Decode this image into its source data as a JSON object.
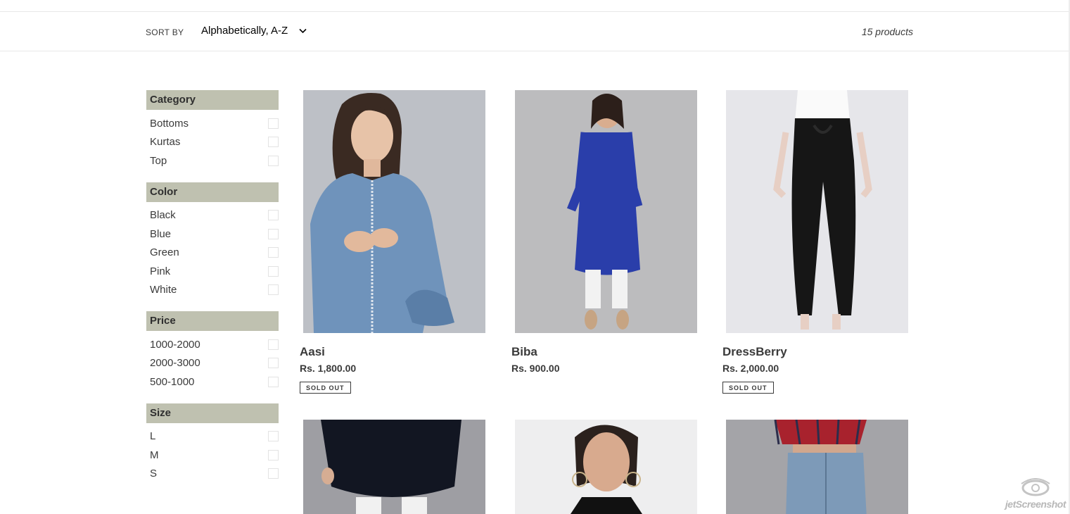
{
  "toolbar": {
    "sort_label": "SORT BY",
    "sort_value": "Alphabetically, A-Z",
    "product_count": "15 products"
  },
  "filters": [
    {
      "header": "Category",
      "options": [
        "Bottoms",
        "Kurtas",
        "Top"
      ]
    },
    {
      "header": "Color",
      "options": [
        "Black",
        "Blue",
        "Green",
        "Pink",
        "White"
      ]
    },
    {
      "header": "Price",
      "options": [
        "1000-2000",
        "2000-3000",
        "500-1000"
      ]
    },
    {
      "header": "Size",
      "options": [
        "L",
        "M",
        "S"
      ]
    }
  ],
  "products": [
    {
      "title": "Aasi",
      "price": "Rs. 1,800.00",
      "badge": "SOLD OUT"
    },
    {
      "title": "Biba",
      "price": "Rs. 900.00",
      "badge": ""
    },
    {
      "title": "DressBerry",
      "price": "Rs. 2,000.00",
      "badge": "SOLD OUT"
    },
    {
      "title": "",
      "price": "",
      "badge": ""
    },
    {
      "title": "",
      "price": "",
      "badge": ""
    },
    {
      "title": "",
      "price": "",
      "badge": ""
    }
  ],
  "watermark": "jetScreenshot",
  "colors": {
    "filter_header_bg": "#bfc1b0",
    "text": "#3a3a3a",
    "border": "#e8e8e8"
  }
}
